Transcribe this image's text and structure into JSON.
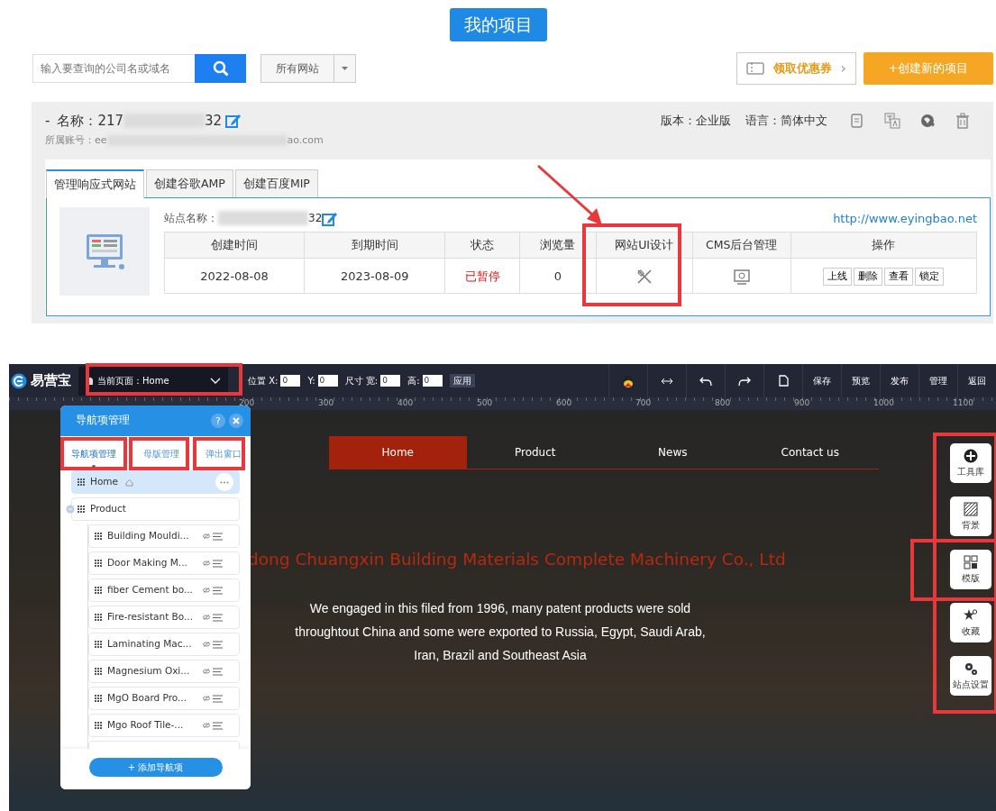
{
  "page_title": "我的项目",
  "search": {
    "placeholder": "输入要查询的公司名或域名"
  },
  "site_filter": {
    "value": "所有网站"
  },
  "coupon_button": {
    "label": "领取优惠券",
    "arrow": "›"
  },
  "create_button": "+创建新的项目",
  "project": {
    "collapse": "-",
    "name_label": "名称：217",
    "name_suffix": "32",
    "account_label": "所属账号：ee",
    "account_suffix": "ao.com",
    "version": "版本：企业版",
    "language": "语言：简体中文",
    "tabs": [
      {
        "label": "管理响应式网站",
        "selected": true
      },
      {
        "label": "创建谷歌AMP",
        "selected": false
      },
      {
        "label": "创建百度MIP",
        "selected": false
      }
    ],
    "site_name_label": "站点名称：",
    "site_name_suffix": "32",
    "site_url": "http://www.eyingbao.net",
    "table": {
      "columns": [
        "创建时间",
        "到期时间",
        "状态",
        "浏览量",
        "网站UI设计",
        "CMS后台管理",
        "操作"
      ],
      "rows": [
        {
          "created": "2022-08-08",
          "expires": "2023-08-09",
          "status": "已暂停",
          "views": "0",
          "actions": [
            "上线",
            "删除",
            "查看",
            "锁定"
          ]
        }
      ]
    }
  },
  "editor": {
    "logo": "易营宝",
    "current_page": "当前页面：Home",
    "fields": [
      {
        "label": "位置 X:",
        "value": "0"
      },
      {
        "label": "Y:",
        "value": "0"
      },
      {
        "label": "尺寸 宽:",
        "value": "0"
      },
      {
        "label": "高:",
        "value": "0"
      }
    ],
    "apply": "应用",
    "actions": [
      "保存",
      "预览",
      "发布",
      "管理",
      "返回"
    ],
    "ruler": [
      "200",
      "300",
      "400",
      "500",
      "600",
      "700",
      "800",
      "900",
      "1000",
      "1100"
    ],
    "panel": {
      "title": "导航项管理",
      "help": "?",
      "tabs": [
        {
          "label": "导航项管理",
          "selected": true
        },
        {
          "label": "母版管理",
          "selected": false
        },
        {
          "label": "弹出窗口",
          "selected": false
        }
      ],
      "tree": [
        {
          "label": "Home",
          "selected": true,
          "home": true
        },
        {
          "label": "Product",
          "selected": false,
          "home": false,
          "expanded": true,
          "children": [
            {
              "label": "Building Mouldi..."
            },
            {
              "label": "Door Making M..."
            },
            {
              "label": "fiber Cement bo..."
            },
            {
              "label": "Fire-resistant Bo..."
            },
            {
              "label": "Laminating Mac..."
            },
            {
              "label": "Magnesium Oxi..."
            },
            {
              "label": "MgO Board Pro..."
            },
            {
              "label": "Mgo Roof Tile-..."
            }
          ]
        }
      ],
      "add_button": "+ 添加导航项"
    },
    "site_nav": [
      {
        "label": "Home",
        "selected": true
      },
      {
        "label": "Product",
        "selected": false
      },
      {
        "label": "News",
        "selected": false
      },
      {
        "label": "Contact us",
        "selected": false
      }
    ],
    "headline": "dong Chuangxin Building Materials Complete Machinery Co., Ltd",
    "intro": "We engaged in this filed from 1996,  many patent products were sold throughtout China and some were exported to Russia,  Egypt,  Saudi  Arab,  Iran,  Brazil and Southeast Asia",
    "tools": [
      {
        "label": "工具库",
        "kind": "plus"
      },
      {
        "label": "背景",
        "kind": "hatch"
      },
      {
        "label": "模版",
        "kind": "grid"
      },
      {
        "label": "收藏",
        "kind": "star"
      },
      {
        "label": "站点设置",
        "kind": "gears"
      }
    ]
  }
}
